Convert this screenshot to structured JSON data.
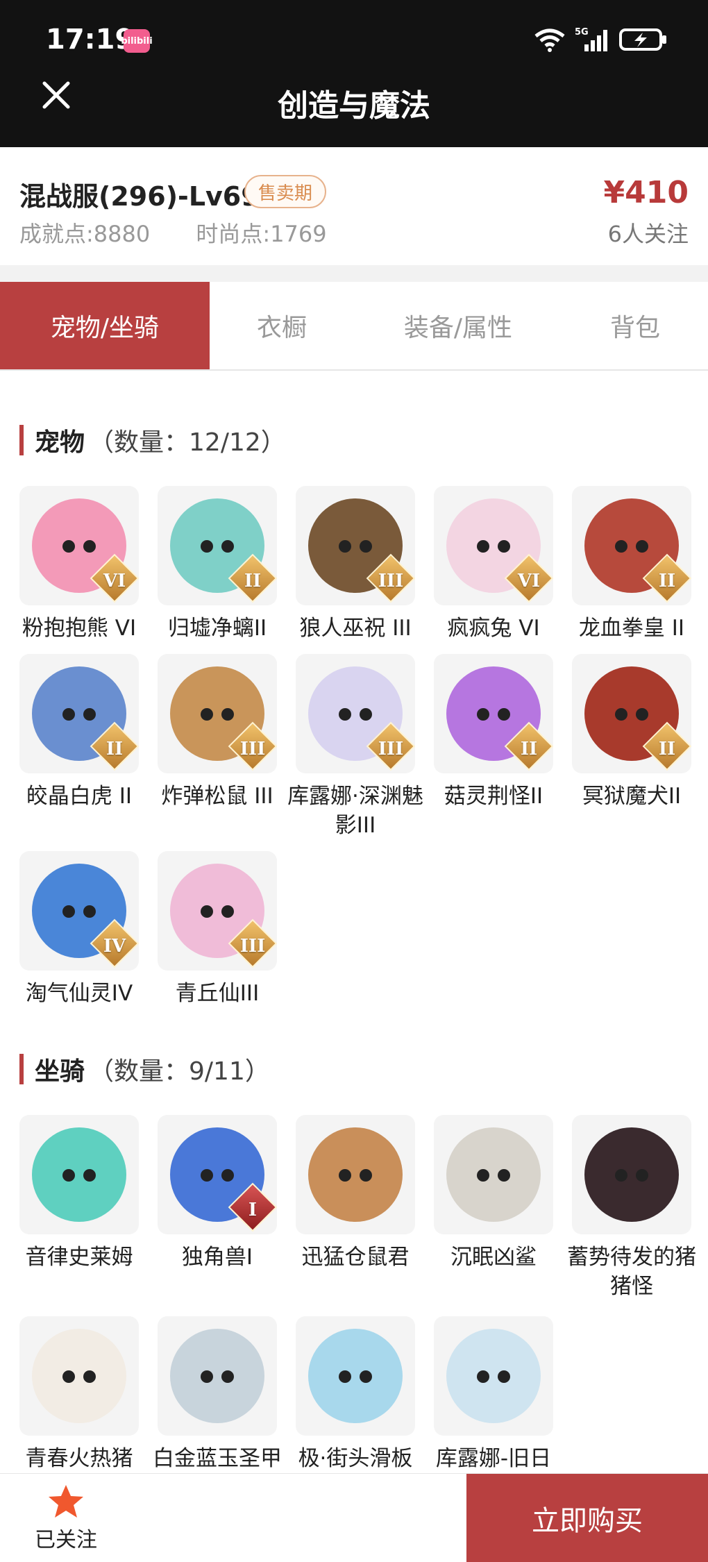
{
  "status_bar": {
    "time": "17:19",
    "app_badge": "bilibili",
    "network": "5G"
  },
  "header": {
    "title": "创造与魔法"
  },
  "listing": {
    "server": "混战服(296)-Lv69",
    "sale_status": "售卖期",
    "achievement": "成就点:8880",
    "fashion": "时尚点:1769",
    "price": "¥410",
    "followers": "6人关注"
  },
  "tabs": [
    {
      "label": "宠物/坐骑",
      "active": true
    },
    {
      "label": "衣橱",
      "active": false
    },
    {
      "label": "装备/属性",
      "active": false
    },
    {
      "label": "背包",
      "active": false
    }
  ],
  "pets": {
    "title": "宠物",
    "count": "（数量：12/12）",
    "items": [
      {
        "name": "粉抱抱熊 VI",
        "rank": "VI",
        "color": "#f39ab8"
      },
      {
        "name": "归墟净螭II",
        "rank": "II",
        "color": "#7fd0c8"
      },
      {
        "name": "狼人巫祝 III",
        "rank": "III",
        "color": "#7a5a3a"
      },
      {
        "name": "疯疯兔 VI",
        "rank": "VI",
        "color": "#f3d5e2"
      },
      {
        "name": "龙血拳皇 II",
        "rank": "II",
        "color": "#b74a3c"
      },
      {
        "name": "皎晶白虎 II",
        "rank": "II",
        "color": "#6a8fd0"
      },
      {
        "name": "炸弹松鼠 III",
        "rank": "III",
        "color": "#c9955a"
      },
      {
        "name": "库露娜·深渊魅影III",
        "rank": "III",
        "color": "#d9d4f0"
      },
      {
        "name": "菇灵荆怪II",
        "rank": "II",
        "color": "#b676e0"
      },
      {
        "name": "冥狱魔犬II",
        "rank": "II",
        "color": "#a83a2c"
      },
      {
        "name": "淘气仙灵IV",
        "rank": "IV",
        "color": "#4a86d8"
      },
      {
        "name": "青丘仙III",
        "rank": "III",
        "color": "#f0bcd8"
      }
    ]
  },
  "mounts": {
    "title": "坐骑",
    "count": "（数量：9/11）",
    "items": [
      {
        "name": "音律史莱姆",
        "rank": "",
        "color": "#5fd0c0"
      },
      {
        "name": "独角兽I",
        "rank": "I",
        "color": "#4a78d8"
      },
      {
        "name": "迅猛仓鼠君",
        "rank": "",
        "color": "#c98f5a"
      },
      {
        "name": "沉眠凶鲨",
        "rank": "",
        "color": "#d8d4cc"
      },
      {
        "name": "蓄势待发的猪猪怪",
        "rank": "",
        "color": "#3a2a2e"
      },
      {
        "name": "青春火热猪",
        "rank": "",
        "color": "#f2ece4"
      },
      {
        "name": "白金蓝玉圣甲虫",
        "rank": "",
        "color": "#c8d4dc"
      },
      {
        "name": "极·街头滑板",
        "rank": "",
        "color": "#a8d8ec"
      },
      {
        "name": "库露娜-旧日之歌",
        "rank": "",
        "color": "#cfe4f0"
      }
    ]
  },
  "bottom_bar": {
    "follow_label": "已关注",
    "buy_label": "立即购买"
  },
  "colors": {
    "accent": "#b84040",
    "star": "#f0582e"
  }
}
